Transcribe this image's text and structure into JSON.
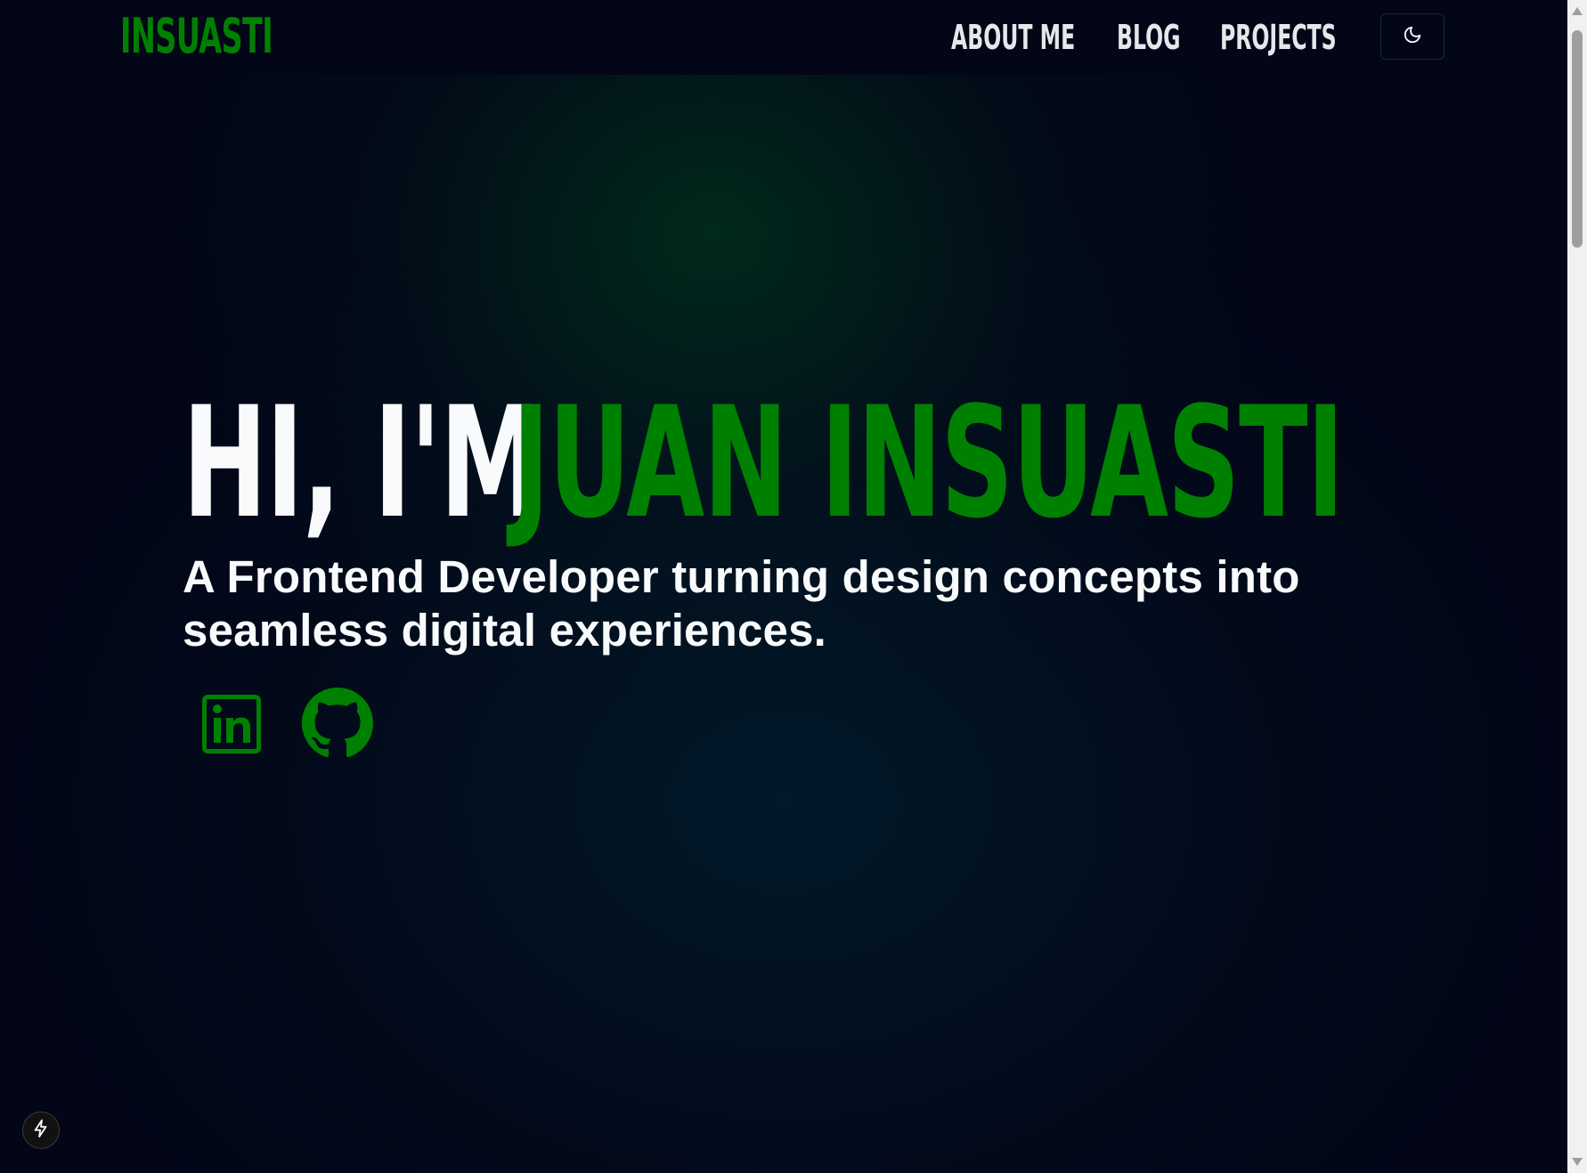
{
  "header": {
    "logo": "INSUASTI",
    "nav": [
      {
        "label": "ABOUT ME"
      },
      {
        "label": "BLOG"
      },
      {
        "label": "PROJECTS"
      }
    ],
    "theme_toggle_icon": "moon-icon"
  },
  "hero": {
    "greeting": "HI, I'M",
    "name": "JUAN INSUASTI",
    "subtitle": "A Frontend Developer turning design concepts into seamless digital experiences.",
    "socials": [
      {
        "icon": "linkedin-icon"
      },
      {
        "icon": "github-icon"
      }
    ]
  },
  "floating_button": {
    "icon": "lightning-icon"
  },
  "colors": {
    "background": "#020617",
    "accent": "#008000",
    "text": "#f8fafc"
  }
}
